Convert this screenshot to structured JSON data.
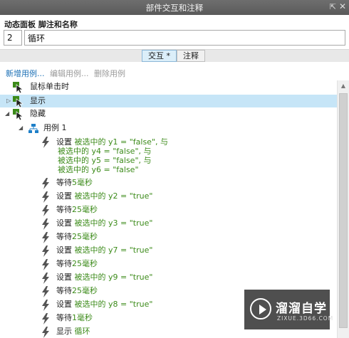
{
  "window": {
    "title": "部件交互和注释"
  },
  "panel": {
    "label": "动态面板 脚注和名称",
    "footnote": "2",
    "name": "循环"
  },
  "tabs": [
    {
      "label": "交互 *"
    },
    {
      "label": "注释"
    }
  ],
  "toolbar": {
    "new_case": "新增用例...",
    "edit_case": "编辑用例...",
    "delete_case": "删除用例"
  },
  "tree": {
    "events": [
      "鼠标单击时",
      "显示",
      "隐藏"
    ],
    "case_name": "用例 1",
    "actions": [
      {
        "verb": "设置",
        "lines": [
          "被选中的 y1 = \"false\", 与",
          "被选中的 y4 = \"false\", 与",
          "被选中的 y5 = \"false\", 与",
          "被选中的 y6 = \"false\""
        ]
      },
      {
        "verb": "等待",
        "detail": "5毫秒"
      },
      {
        "verb": "设置",
        "detail": "被选中的 y2 = \"true\""
      },
      {
        "verb": "等待",
        "detail": "25毫秒"
      },
      {
        "verb": "设置",
        "detail": "被选中的 y3 = \"true\""
      },
      {
        "verb": "等待",
        "detail": "25毫秒"
      },
      {
        "verb": "设置",
        "detail": "被选中的 y7 = \"true\""
      },
      {
        "verb": "等待",
        "detail": "25毫秒"
      },
      {
        "verb": "设置",
        "detail": "被选中的 y9 = \"true\""
      },
      {
        "verb": "等待",
        "detail": "25毫秒"
      },
      {
        "verb": "设置",
        "detail": "被选中的 y8 = \"true\""
      },
      {
        "verb": "等待",
        "detail": "1毫秒"
      },
      {
        "verb": "显示",
        "detail": "循环"
      }
    ]
  },
  "watermark": {
    "title": "溜溜自学",
    "subtitle": "ZIXUE.3D66.COM"
  },
  "colors": {
    "accent_green": "#3c8b1a",
    "link_blue": "#1a6fb5",
    "selection": "#c6e5f7"
  }
}
